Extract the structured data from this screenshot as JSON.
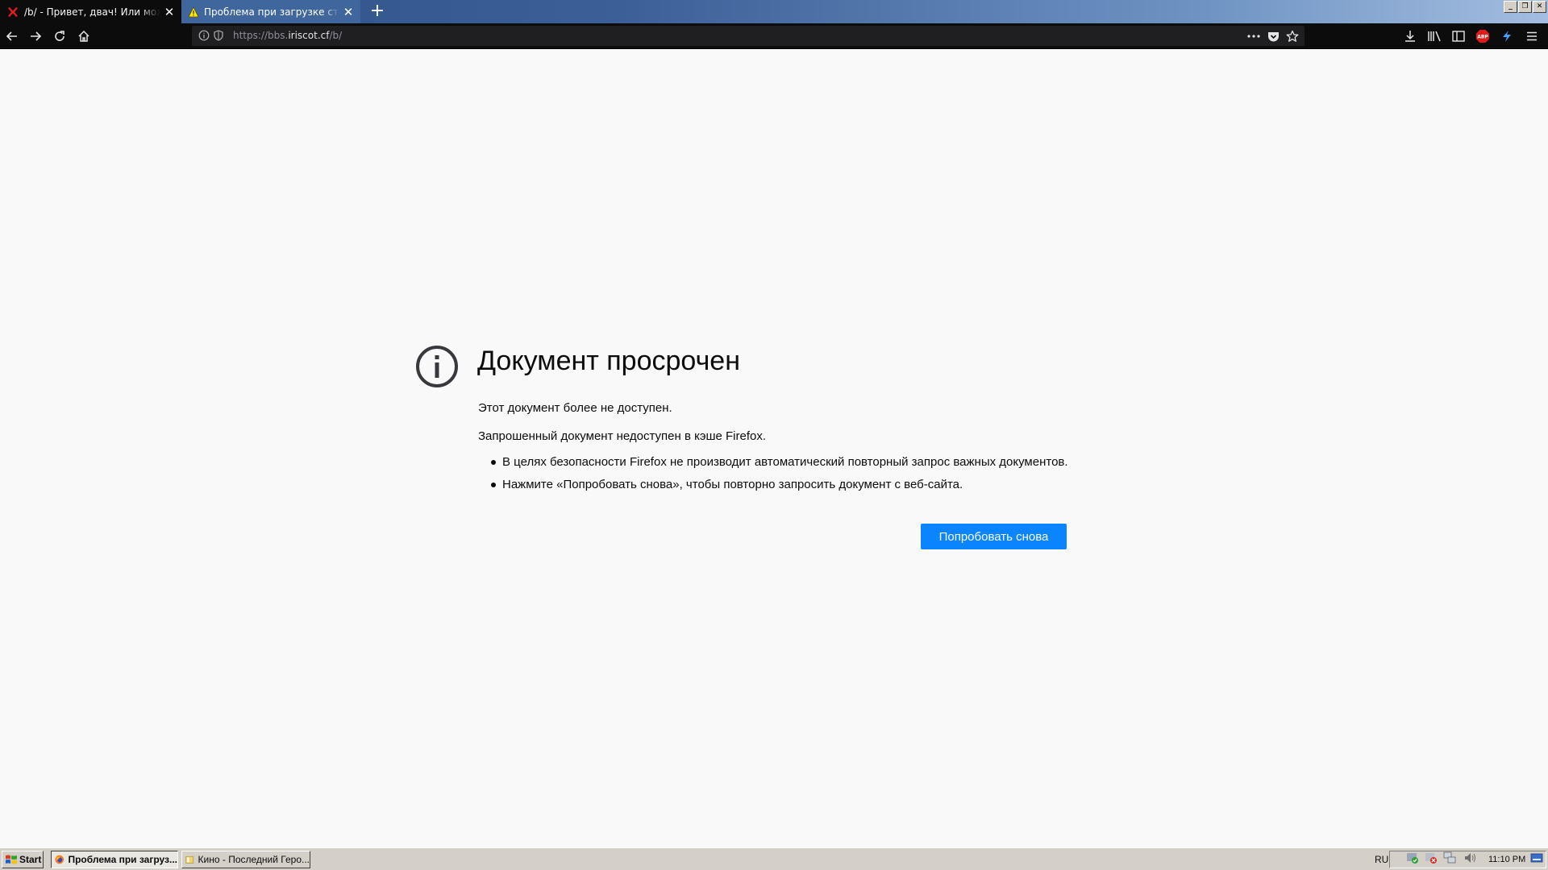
{
  "tabs": [
    {
      "title": "/b/ - Привет, двач! Или может б",
      "icon": "close-x-red-icon",
      "active": true
    },
    {
      "title": "Проблема при загрузке страниц",
      "icon": "warning-icon",
      "active": false
    }
  ],
  "window_buttons": {
    "minimize": "_",
    "restore": "❐",
    "close": "✕"
  },
  "url": {
    "prefix": "https://bbs.",
    "host": "iriscot.cf",
    "path": "/b/"
  },
  "error": {
    "title": "Документ просрочен",
    "line1": "Этот документ более не доступен.",
    "line2": "Запрошенный документ недоступен в кэше Firefox.",
    "bullets": [
      "В целях безопасности Firefox не производит автоматический повторный запрос важных документов.",
      "Нажмите «Попробовать снова», чтобы повторно запросить документ с веб-сайта."
    ],
    "retry_label": "Попробовать снова"
  },
  "taskbar": {
    "start_label": "Start",
    "tasks": [
      {
        "label": "Проблема при загруз...",
        "active": true
      },
      {
        "label": "Кино - Последний Геро...",
        "active": false
      }
    ],
    "lang": "RU",
    "clock": "11:10 PM"
  },
  "colors": {
    "accent": "#0a84ff",
    "chrome_dark": "#0c0c0d",
    "page_bg": "#f9f9fa",
    "abp_red": "#e01b1b"
  }
}
